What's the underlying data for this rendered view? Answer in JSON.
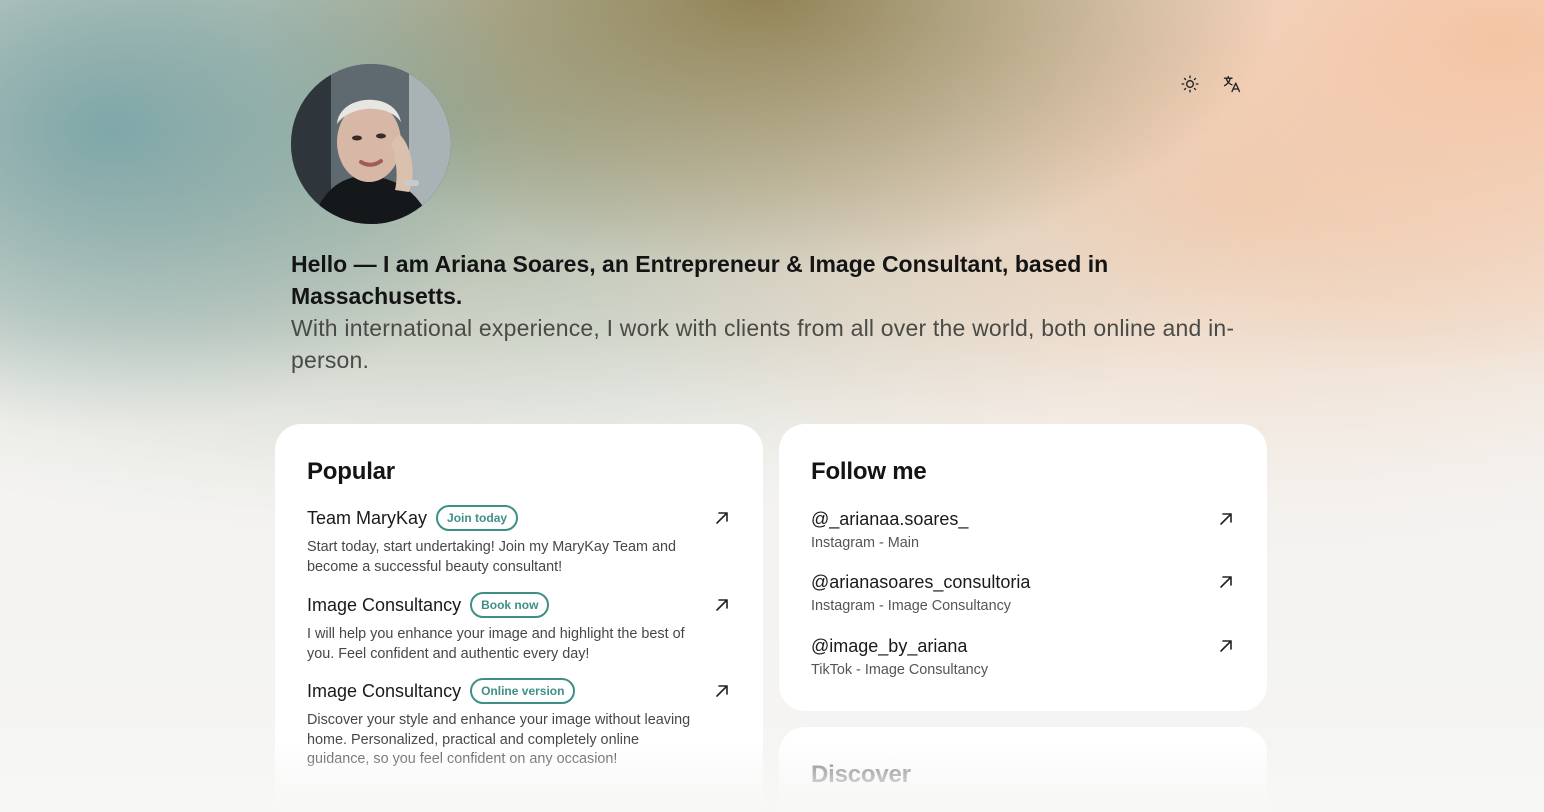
{
  "profile": {
    "avatar_alt": "Ariana Soares profile photo",
    "headline": "Hello — I am Ariana Soares, an Entrepreneur & Image Consultant, based in Massachusetts.",
    "subline": "With international experience, I work with clients from all over the world, both online and in-person."
  },
  "controls": {
    "theme_icon": "sun-icon",
    "language_icon": "translate-icon"
  },
  "popular": {
    "title": "Popular",
    "items": [
      {
        "title": "Team MaryKay",
        "badge": "Join today",
        "description": "Start today, start undertaking! Join my MaryKay Team and become a successful beauty consultant!"
      },
      {
        "title": "Image Consultancy",
        "badge": "Book now",
        "description": "I will help you enhance your image and highlight the best of you. Feel confident and authentic every day!"
      },
      {
        "title": "Image Consultancy",
        "badge": "Online version",
        "description": "Discover your style and enhance your image without leaving home. Personalized, practical and completely online guidance, so you feel confident on any occasion!"
      }
    ]
  },
  "follow": {
    "title": "Follow me",
    "items": [
      {
        "handle": "@_arianaa.soares_",
        "platform": "Instagram - Main"
      },
      {
        "handle": "@arianasoares_consultoria",
        "platform": "Instagram - Image Consultancy"
      },
      {
        "handle": "@image_by_ariana",
        "platform": "TikTok - Image Consultancy"
      }
    ]
  },
  "discover": {
    "title": "Discover"
  },
  "colors": {
    "accent": "#3f8f86",
    "card_bg": "#ffffff",
    "text": "#141414"
  }
}
